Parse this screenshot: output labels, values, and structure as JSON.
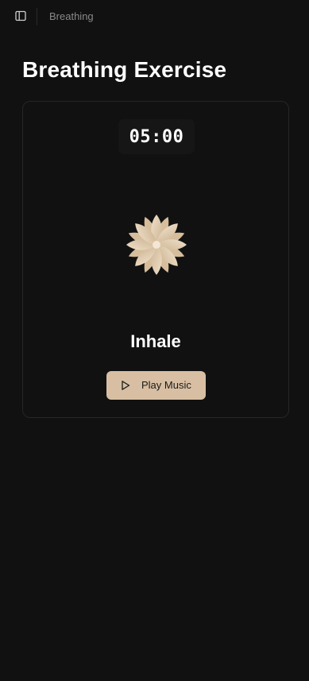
{
  "header": {
    "breadcrumb": "Breathing",
    "sidebar_toggle_icon": "sidebar-panel-icon"
  },
  "main": {
    "title": "Breathing Exercise",
    "timer": "05:00",
    "phase": "Inhale",
    "play_button_label": "Play Music",
    "play_icon": "play-icon",
    "flower_icon": "lotus-flower-icon"
  },
  "colors": {
    "background": "#111111",
    "card_border": "#262626",
    "accent": "#d8bfa3",
    "muted_text": "#8a8a8a"
  }
}
